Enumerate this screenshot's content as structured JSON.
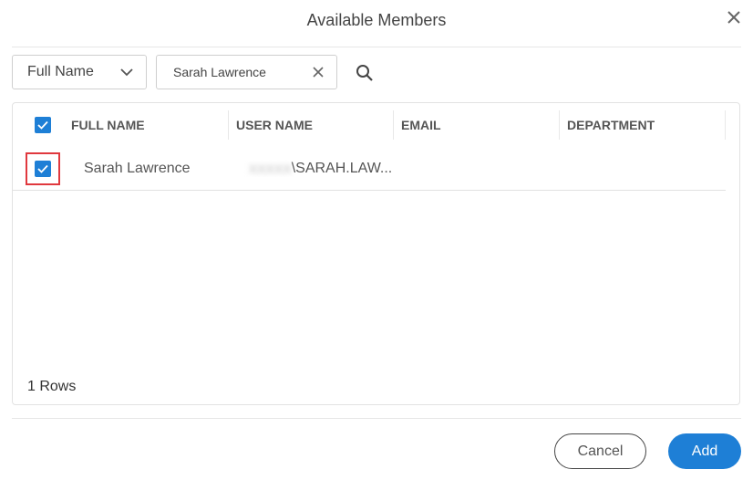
{
  "dialog": {
    "title": "Available Members"
  },
  "filter": {
    "field_selected": "Full Name",
    "search_value": "Sarah Lawrence"
  },
  "table": {
    "columns": [
      "FULL NAME",
      "USER NAME",
      "EMAIL",
      "DEPARTMENT"
    ],
    "rows": [
      {
        "full_name": "Sarah Lawrence",
        "user_name_redacted": "XXXXX",
        "user_name_visible": "\\SARAH.LAW...",
        "email": "",
        "department": "",
        "checked": true
      }
    ],
    "row_count_label": "1 Rows"
  },
  "buttons": {
    "cancel_label": "Cancel",
    "add_label": "Add"
  },
  "colors": {
    "accent": "#1e7fd6",
    "highlight": "#e0383e"
  }
}
